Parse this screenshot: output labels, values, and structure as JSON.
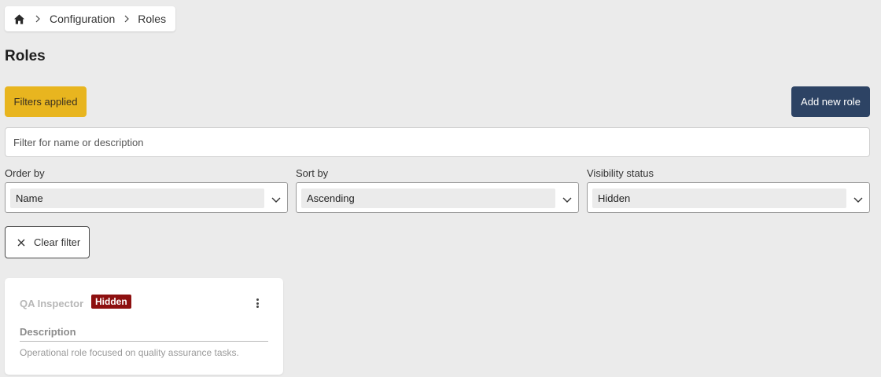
{
  "breadcrumb": {
    "home_icon": "home-icon",
    "items": [
      "Configuration",
      "Roles"
    ]
  },
  "page": {
    "title": "Roles"
  },
  "actions": {
    "filters_label": "Filters applied",
    "add_label": "Add new role"
  },
  "search": {
    "placeholder": "Filter for name or description",
    "value": ""
  },
  "filters": {
    "order_by": {
      "label": "Order by",
      "value": "Name"
    },
    "sort_by": {
      "label": "Sort by",
      "value": "Ascending"
    },
    "visibility": {
      "label": "Visibility status",
      "value": "Hidden"
    }
  },
  "clear": {
    "label": "Clear filter",
    "icon": "close-icon"
  },
  "roles": [
    {
      "name": "QA Inspector",
      "badge": "Hidden",
      "description_label": "Description",
      "description": "Operational role focused on quality assurance tasks."
    }
  ],
  "colors": {
    "background": "#ebebeb",
    "filters_button": "#e8b51f",
    "add_button": "#2d4364",
    "hidden_badge": "#8d1010"
  }
}
